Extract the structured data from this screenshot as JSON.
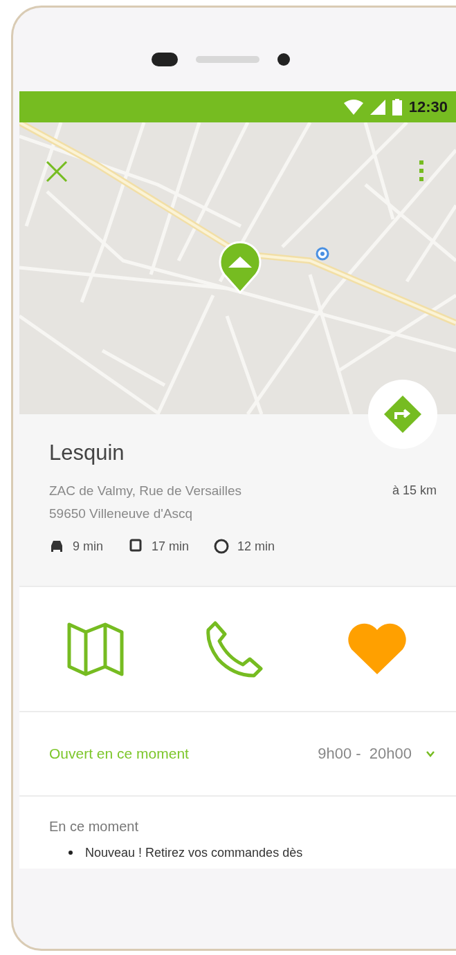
{
  "status_bar": {
    "time": "12:30"
  },
  "place": {
    "name": "Lesquin",
    "address_lines": [
      "ZAC de Valmy, Rue de Versailles",
      "59650 Villeneuve d'Ascq"
    ],
    "distance": "à 15 km",
    "travel_times": [
      {
        "kind": "car",
        "duration": "9 min"
      },
      {
        "kind": "transit",
        "duration": "17 min"
      },
      {
        "kind": "walk",
        "duration": "12 min"
      }
    ]
  },
  "actions": [
    {
      "kind": "map"
    },
    {
      "kind": "phone"
    },
    {
      "kind": "favorite",
      "on": true
    }
  ],
  "hours": {
    "status": "Ouvert en ce moment",
    "range": "9h00 -  20h00",
    "expanded": false
  },
  "news": {
    "title": "En ce moment",
    "items": [
      "Nouveau ! Retirez vos commandes dès"
    ]
  }
}
